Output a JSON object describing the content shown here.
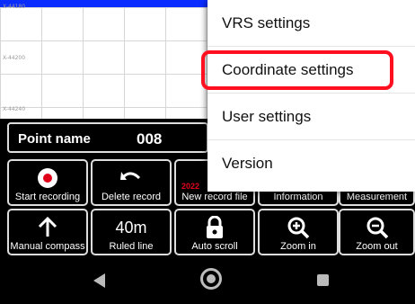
{
  "map": {
    "coords": [
      "X-44180",
      "X-44200",
      "X-44240"
    ]
  },
  "point": {
    "label": "Point name",
    "value": "008"
  },
  "buttons": {
    "start_recording": "Start recording",
    "delete_record": "Delete record",
    "new_record_file": "New record file",
    "information": "Information",
    "measurement": "Measurement",
    "manual_compass": "Manual compass",
    "ruled_line": "Ruled line",
    "ruled_value": "40m",
    "auto_scroll": "Auto scroll",
    "zoom_in": "Zoom in",
    "zoom_out": "Zoom out",
    "partial_date": "2022"
  },
  "menu": {
    "items": [
      "VRS settings",
      "Coordinate settings",
      "User settings",
      "Version"
    ],
    "highlighted": "Coordinate settings"
  },
  "colors": {
    "accent_red": "#ff1020",
    "topbar_blue": "#0a2cff"
  }
}
